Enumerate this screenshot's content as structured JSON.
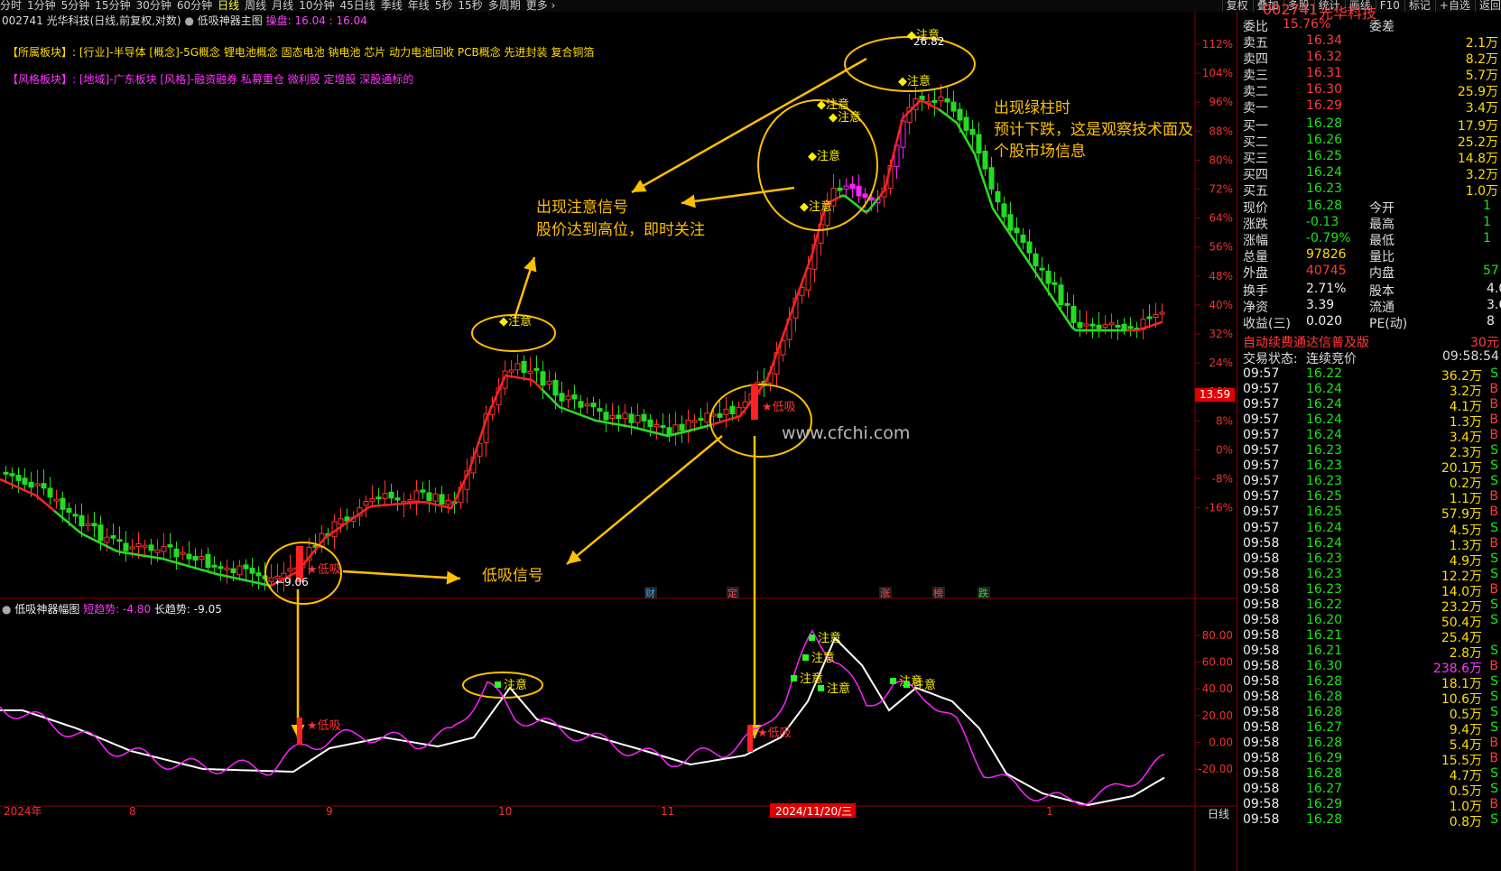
{
  "toolbar": {
    "periods": [
      "分时",
      "1分钟",
      "5分钟",
      "15分钟",
      "30分钟",
      "60分钟",
      "日线",
      "周线",
      "月线",
      "10分钟",
      "45日线",
      "季线",
      "年线",
      "5秒",
      "15秒",
      "多周期",
      "更多 ›"
    ],
    "active_period": "日线",
    "right_buttons": [
      "复权",
      "叠加",
      "多股",
      "统计",
      "画线",
      "F10",
      "标记",
      "+自选",
      "返回"
    ]
  },
  "main_chart": {
    "title": "002741 光华科技(日线,前复权,对数)",
    "indicator_name": "低吸神器主图",
    "readout_label": "操盘:",
    "readout_value": "16.04 : 16.04",
    "sector_line_label": "【所属板块】:",
    "sector_line": "[行业]-半导体 [概念]-5G概念 锂电池概念 固态电池 钠电池 芯片 动力电池回收 PCB概念 先进封装 复合铜箔",
    "style_line_label": "【风格板块】:",
    "style_line": "[地域]-广东板块 [风格]-融资融券 私募重仓 微利股 定增股 深股通标的",
    "pct_axis": [
      "112%",
      "104%",
      "96%",
      "88%",
      "80%",
      "72%",
      "64%",
      "56%",
      "48%",
      "40%",
      "32%",
      "24%",
      "16%",
      "8%",
      "0%",
      "-8%",
      "-16%"
    ],
    "price_tag": "13.59",
    "high_label": "26.82",
    "low_label": "9.06",
    "watermark": "www.cfchi.com",
    "event_markers": [
      "财",
      "定",
      "涨",
      "榜",
      "跌"
    ],
    "signal_attention": "注意",
    "signal_buy": "★低吸"
  },
  "annotations": {
    "attention_title": "出现注意信号",
    "attention_sub": "股价达到高位，即时关注",
    "green_title": "出现绿柱时",
    "green_l2": "预计下跌，这是观察技术面及",
    "green_l3": "个股市场信息",
    "buy": "低吸信号"
  },
  "sub_chart": {
    "name": "低吸神器幅图",
    "short_label": "短趋势:",
    "short_value": "-4.80",
    "long_label": "长趋势:",
    "long_value": "-9.05",
    "axis": [
      "80.00",
      "60.00",
      "40.00",
      "20.00",
      "0.00",
      "-20.00"
    ]
  },
  "xaxis": {
    "labels": [
      "2024年",
      "8",
      "9",
      "10",
      "11",
      "2024/11/20/三",
      "1"
    ],
    "period_tag": "日线"
  },
  "quote": {
    "code": "002741",
    "name": "光华科技",
    "weibi_label": "委比",
    "weibi": "15.76%",
    "weicha_label": "委差",
    "asks": [
      {
        "l": "卖五",
        "p": "16.34",
        "v": "2.1万"
      },
      {
        "l": "卖四",
        "p": "16.32",
        "v": "8.2万"
      },
      {
        "l": "卖三",
        "p": "16.31",
        "v": "5.7万"
      },
      {
        "l": "卖二",
        "p": "16.30",
        "v": "25.9万"
      },
      {
        "l": "卖一",
        "p": "16.29",
        "v": "3.4万"
      }
    ],
    "bids": [
      {
        "l": "买一",
        "p": "16.28",
        "v": "17.9万"
      },
      {
        "l": "买二",
        "p": "16.26",
        "v": "25.2万"
      },
      {
        "l": "买三",
        "p": "16.25",
        "v": "14.8万"
      },
      {
        "l": "买四",
        "p": "16.24",
        "v": "3.2万"
      },
      {
        "l": "买五",
        "p": "16.23",
        "v": "1.0万"
      }
    ],
    "stats": [
      {
        "a": "现价",
        "b": "16.28",
        "bc": "green",
        "c": "今开",
        "d": "1"
      },
      {
        "a": "涨跌",
        "b": "-0.13",
        "bc": "green",
        "c": "最高",
        "d": "1"
      },
      {
        "a": "涨幅",
        "b": "-0.79%",
        "bc": "green",
        "c": "最低",
        "d": "1"
      },
      {
        "a": "总量",
        "b": "97826",
        "bc": "yel",
        "c": "量比",
        "d": ""
      },
      {
        "a": "外盘",
        "b": "40745",
        "bc": "red",
        "c": "内盘",
        "d": "57"
      }
    ],
    "stats2": [
      {
        "a": "换手",
        "b": "2.71%",
        "c": "股本",
        "d": "4.0"
      },
      {
        "a": "净资",
        "b": "3.39",
        "c": "流通",
        "d": "3.6"
      },
      {
        "a": "收益(三)",
        "b": "0.020",
        "c": "PE(动)",
        "d": "8"
      }
    ],
    "ad": "自动续费通达信普及版",
    "ad_price": "30元",
    "trade_state_label": "交易状态:",
    "trade_state": "连续竞价",
    "trade_time": "09:58:54",
    "ticks": [
      {
        "t": "09:57",
        "p": "16.22",
        "v": "36.2万",
        "s": "S"
      },
      {
        "t": "09:57",
        "p": "16.24",
        "v": "3.2万",
        "s": "B"
      },
      {
        "t": "09:57",
        "p": "16.24",
        "v": "4.1万",
        "s": "B"
      },
      {
        "t": "09:57",
        "p": "16.24",
        "v": "1.3万",
        "s": "B"
      },
      {
        "t": "09:57",
        "p": "16.24",
        "v": "3.4万",
        "s": "B"
      },
      {
        "t": "09:57",
        "p": "16.23",
        "v": "2.3万",
        "s": "S"
      },
      {
        "t": "09:57",
        "p": "16.23",
        "v": "20.1万",
        "s": "S"
      },
      {
        "t": "09:57",
        "p": "16.23",
        "v": "0.2万",
        "s": "S"
      },
      {
        "t": "09:57",
        "p": "16.25",
        "v": "1.1万",
        "s": "B"
      },
      {
        "t": "09:57",
        "p": "16.25",
        "v": "57.9万",
        "s": "B"
      },
      {
        "t": "09:57",
        "p": "16.24",
        "v": "4.5万",
        "s": "S"
      },
      {
        "t": "09:58",
        "p": "16.24",
        "v": "1.3万",
        "s": "B"
      },
      {
        "t": "09:58",
        "p": "16.23",
        "v": "4.9万",
        "s": "S"
      },
      {
        "t": "09:58",
        "p": "16.23",
        "v": "12.2万",
        "s": "S"
      },
      {
        "t": "09:58",
        "p": "16.23",
        "v": "14.0万",
        "s": "B"
      },
      {
        "t": "09:58",
        "p": "16.22",
        "v": "23.2万",
        "s": "S"
      },
      {
        "t": "09:58",
        "p": "16.20",
        "v": "50.4万",
        "s": "S"
      },
      {
        "t": "09:58",
        "p": "16.21",
        "v": "25.4万",
        "s": ""
      },
      {
        "t": "09:58",
        "p": "16.21",
        "v": "2.8万",
        "s": "S"
      },
      {
        "t": "09:58",
        "p": "16.30",
        "v": "238.6万",
        "s": "B"
      },
      {
        "t": "09:58",
        "p": "16.28",
        "v": "18.1万",
        "s": "S"
      },
      {
        "t": "09:58",
        "p": "16.28",
        "v": "10.6万",
        "s": "S"
      },
      {
        "t": "09:58",
        "p": "16.28",
        "v": "0.5万",
        "s": "S"
      },
      {
        "t": "09:58",
        "p": "16.27",
        "v": "9.4万",
        "s": "S"
      },
      {
        "t": "09:58",
        "p": "16.28",
        "v": "5.4万",
        "s": "B"
      },
      {
        "t": "09:58",
        "p": "16.29",
        "v": "15.5万",
        "s": "B"
      },
      {
        "t": "09:58",
        "p": "16.28",
        "v": "4.7万",
        "s": "S"
      },
      {
        "t": "09:58",
        "p": "16.27",
        "v": "0.5万",
        "s": "S"
      },
      {
        "t": "09:58",
        "p": "16.29",
        "v": "1.0万",
        "s": "B"
      },
      {
        "t": "09:58",
        "p": "16.28",
        "v": "0.8万",
        "s": "S"
      }
    ]
  },
  "colors": {
    "up": "#ff3333",
    "down": "#22dd22",
    "attention": "#ff22ff",
    "annotation": "#ffc000"
  }
}
